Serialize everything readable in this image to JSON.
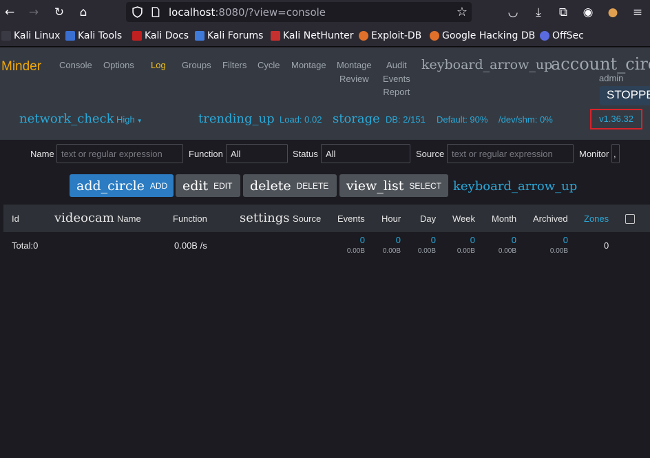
{
  "browser": {
    "url_host": "localhost",
    "url_rest": ":8080/?view=console",
    "bookmarks": [
      "Kali Linux",
      "Kali Tools",
      "Kali Docs",
      "Kali Forums",
      "Kali NetHunter",
      "Exploit-DB",
      "Google Hacking DB",
      "OffSec"
    ]
  },
  "nav": {
    "brand": "Minder",
    "items": [
      "Console",
      "Options",
      "Log",
      "Groups",
      "Filters",
      "Cycle",
      "Montage"
    ],
    "montage_review": [
      "Montage",
      "Review"
    ],
    "audit": [
      "Audit",
      "Events",
      "Report"
    ],
    "icon_arrow": "keyboard_arrow_up",
    "icon_account": "account_circle",
    "user": "admin",
    "state": "STOPPED"
  },
  "status": {
    "icon_network": "network_check",
    "level": "High",
    "icon_trend": "trending_up",
    "load": "Load: 0.02",
    "icon_storage": "storage",
    "db": "DB: 2/151",
    "default": "Default: 90%",
    "shm": "/dev/shm: 0%",
    "version": "v1.36.32"
  },
  "filters": {
    "name_label": "Name",
    "name_placeholder": "text or regular expression",
    "function_label": "Function",
    "function_value": "All",
    "status_label": "Status",
    "status_value": "All",
    "source_label": "Source",
    "source_placeholder": "text or regular expression",
    "monitor_label": "Monitor",
    "monitor_value": ","
  },
  "actions": {
    "add_icon": "add_circle",
    "add": "ADD",
    "edit_icon": "edit",
    "edit": "EDIT",
    "delete_icon": "delete",
    "delete": "DELETE",
    "select_icon": "view_list",
    "select": "SELECT",
    "collapse_icon": "keyboard_arrow_up"
  },
  "table": {
    "headers": {
      "id": "Id",
      "videocam_icon": "videocam",
      "name": "Name",
      "function": "Function",
      "settings_icon": "settings",
      "source": "Source",
      "events": "Events",
      "hour": "Hour",
      "day": "Day",
      "week": "Week",
      "month": "Month",
      "archived": "Archived",
      "zones": "Zones"
    },
    "total": {
      "label": "Total:0",
      "bandwidth": "0.00B /s",
      "events": "0",
      "events_size": "0.00B",
      "hour": "0",
      "hour_size": "0.00B",
      "day": "0",
      "day_size": "0.00B",
      "week": "0",
      "week_size": "0.00B",
      "month": "0",
      "month_size": "0.00B",
      "archived": "0",
      "archived_size": "0.00B",
      "zones": "0"
    }
  }
}
